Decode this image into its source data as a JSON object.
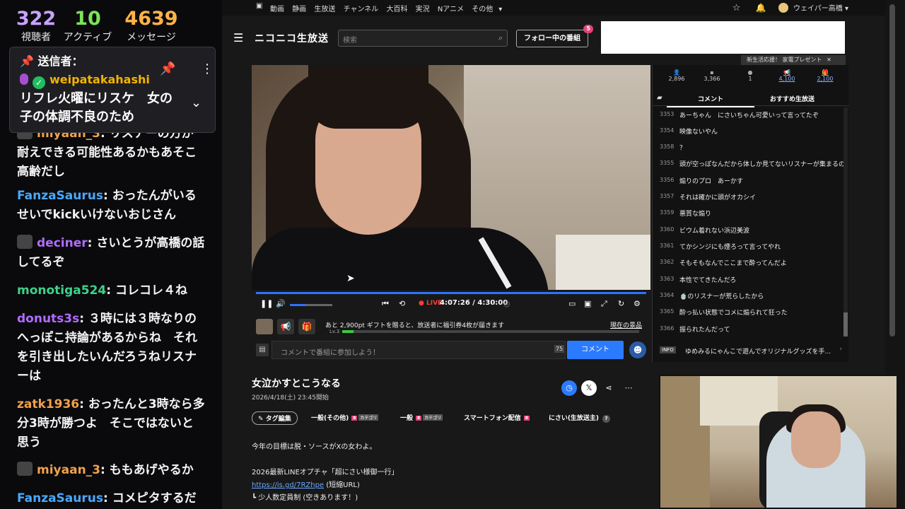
{
  "overlay_stats": {
    "viewers": "322",
    "viewers_label": "視聴者",
    "active": "10",
    "active_label": "アクティブ",
    "messages": "4639",
    "messages_label": "メッセージ",
    "colors": {
      "viewers": "#c7a3ff",
      "active": "#7be35a",
      "messages": "#ffb347"
    }
  },
  "pinned": {
    "header": "送信者：",
    "user": "weipatakahashi",
    "text": "リフレ火曜にリスケ　女の子の体調不良のため"
  },
  "stream_chat": [
    {
      "user": "miyaan_3",
      "color": "#f0a24a",
      "text": "リスナーの方が耐えできる可能性あるかもあそこ高齢だし"
    },
    {
      "user": "FanzaSaurus",
      "color": "#4aa8ff",
      "text": "おったんがいるせいでkickいけないおじさん"
    },
    {
      "user": "deciner",
      "color": "#b06cff",
      "text": "さいとうが高橋の話してるぞ"
    },
    {
      "user": "monotiga524",
      "color": "#3ed18b",
      "text": "コレコレ４ね"
    },
    {
      "user": "donuts3s",
      "color": "#b06cff",
      "text": "３時には３時なりのへっぽこ持論があるからね　それを引き出したいんだろうねリスナーは"
    },
    {
      "user": "zatk1936",
      "color": "#f0a24a",
      "text": "おったんと3時なら多分3時が勝つよ　そこではないと思う"
    },
    {
      "user": "miyaan_3",
      "color": "#f0a24a",
      "text": "ももあげやるか"
    },
    {
      "user": "FanzaSaurus",
      "color": "#4aa8ff",
      "text": "コメピタするだけ"
    }
  ],
  "topbar": {
    "links": [
      "動画",
      "静画",
      "生放送",
      "チャンネル",
      "大百科",
      "実況",
      "Nアニメ",
      "その他"
    ],
    "user": "ウェイパー高橋"
  },
  "header": {
    "logo": "ニコニコ生放送",
    "search_placeholder": "検索",
    "follow_button": "フォロー中の番組",
    "follow_count": "5",
    "promo": "新生活応援！ 家電プレゼント"
  },
  "player": {
    "live_label": "LIVE",
    "time": "4:07:26 / 4:30:00",
    "progress_fraction": 0.916
  },
  "gift": {
    "text": "あと 2,900pt ギフトを贈ると、放送者に福引券4枚が届きます",
    "level": "Lv.3",
    "now_items": "現在の景品"
  },
  "comment_input": {
    "placeholder": "コメントで番組に参加しよう！",
    "char_count": "75",
    "submit": "コメント"
  },
  "side_stats": [
    "2,896",
    "3,366",
    "1",
    "4,100",
    "2,100"
  ],
  "side_tabs": {
    "comments": "コメント",
    "recommended": "おすすめ生放送"
  },
  "comments": [
    {
      "no": "3353",
      "text": "あーちゃん　にさいちゃん可愛いって言ってたぞ"
    },
    {
      "no": "3354",
      "text": "映像ないやん"
    },
    {
      "no": "3358",
      "text": "？"
    },
    {
      "no": "3355",
      "text": "頭が空っぽなんだから体しか見てないリスナーが集まるのは"
    },
    {
      "no": "3356",
      "text": "煽りのプロ　あーかす"
    },
    {
      "no": "3357",
      "text": "それは確かに頭がオカシイ"
    },
    {
      "no": "3359",
      "text": "悪質な煽り"
    },
    {
      "no": "3360",
      "text": "ビウム着れない浜辺美波"
    },
    {
      "no": "3361",
      "text": "てかシンジにも煙ろって言ってやれ"
    },
    {
      "no": "3362",
      "text": "そもそもなんでここまで酔ってんだよ"
    },
    {
      "no": "3363",
      "text": "本性でてきたんだろ"
    },
    {
      "no": "3364",
      "text": "🍵のリスナーが荒らしたから"
    },
    {
      "no": "3365",
      "text": "酔っ払い状態でコメに煽られて狂った"
    },
    {
      "no": "3366",
      "text": "振られたんだって"
    }
  ],
  "info_bar": {
    "tag": "INFO",
    "text": "ゆめみるにゃんこで遊んでオリジナルグッズを手..."
  },
  "program": {
    "title": "女泣かすとこうなる",
    "date": "2026/4/18(土) 23:45開始",
    "tag_edit": "タグ編集",
    "tags": [
      "一般(その他)",
      "一般",
      "スマートフォン配信",
      "にさい(生放送主)"
    ],
    "tag_lock": "8",
    "tag_cat": "カテゴリ",
    "desc_line1": "今年の目標は脱・ソースがXの女わよ。",
    "desc_line2": "2026最新LINEオプチャ「超にさい様御一行」",
    "desc_link": "https://is.gd/7RZhpe",
    "desc_link_note": " (短縮URL)",
    "desc_line3": "┗ 少人数定員制 (空きあります！)"
  }
}
